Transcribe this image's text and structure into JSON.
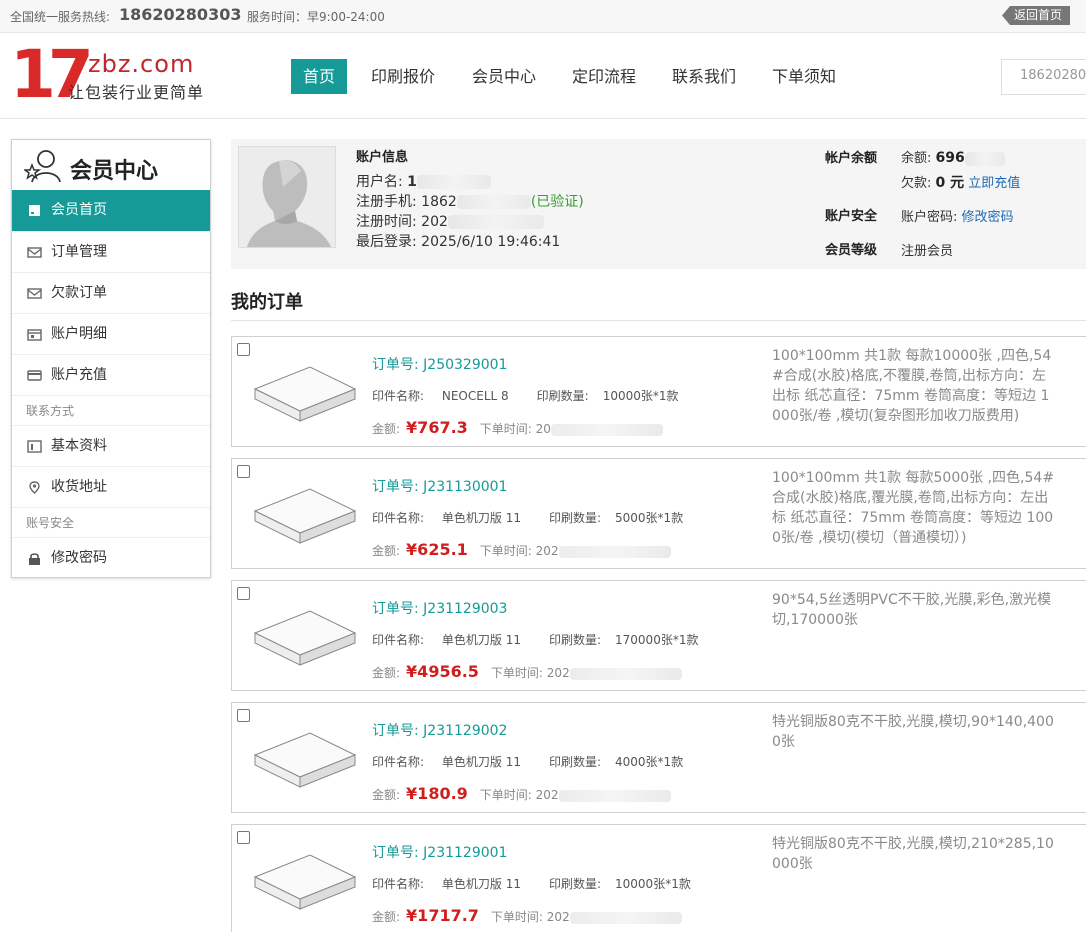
{
  "topbar": {
    "hotline_label": "全国统一服务热线:",
    "hotline": "18620280303",
    "service_time": "服务时间：早9:00-24:00",
    "back_home": "返回首页"
  },
  "logo": {
    "number": "17",
    "domain": "zbz.com",
    "slogan": "让包装行业更简单"
  },
  "nav": {
    "items": [
      "首页",
      "印刷报价",
      "会员中心",
      "定印流程",
      "联系我们",
      "下单须知"
    ],
    "active": "首页"
  },
  "header_search": {
    "value": "18620280"
  },
  "sidebar": {
    "title": "会员中心",
    "items": [
      {
        "label": "会员首页",
        "icon": "home-icon"
      },
      {
        "label": "订单管理",
        "icon": "envelope-icon"
      },
      {
        "label": "欠款订单",
        "icon": "envelope-icon"
      },
      {
        "label": "账户明细",
        "icon": "calendar-icon"
      },
      {
        "label": "账户充值",
        "icon": "card-icon"
      }
    ],
    "section_contact": "联系方式",
    "contact_items": [
      {
        "label": "基本资料",
        "icon": "profile-icon"
      },
      {
        "label": "收货地址",
        "icon": "location-icon"
      }
    ],
    "section_security": "账号安全",
    "security_items": [
      {
        "label": "修改密码",
        "icon": "lock-icon"
      }
    ]
  },
  "account": {
    "title": "账户信息",
    "username_label": "用户名:",
    "username": "1",
    "phone_label": "注册手机:",
    "phone": "1862",
    "verified": "(已验证)",
    "reg_time_label": "注册时间:",
    "reg_time": "202",
    "last_login_label": "最后登录:",
    "last_login": "2025/6/10 19:46:41",
    "balance_label": "帐户余额",
    "balance_amount_label": "余额:",
    "balance_amount": "696",
    "debt_label": "欠款:",
    "debt_amount": "0 元",
    "recharge_link": "立即充值",
    "security_label": "账户安全",
    "password_label": "账户密码:",
    "change_password_link": "修改密码",
    "level_label": "会员等级",
    "level_value": "注册会员"
  },
  "orders_title": "我的订单",
  "order_labels": {
    "no": "订单号:",
    "product": "印件名称:",
    "qty": "印刷数量:",
    "amount": "金额:",
    "time": "下单时间:"
  },
  "orders": [
    {
      "no": "J250329001",
      "product": "NEOCELL 8",
      "qty": "10000张*1款",
      "amount": "¥767.3",
      "time": "20",
      "desc": "100*100mm 共1款 每款10000张 ,四色,54#合成(水胶)格底,不覆膜,卷筒,出标方向：左出标 纸芯直径：75mm 卷筒高度：等短边 1000张/卷 ,模切(复杂图形加收刀版费用)"
    },
    {
      "no": "J231130001",
      "product": "单色机刀版 11",
      "qty": "5000张*1款",
      "amount": "¥625.1",
      "time": "202",
      "desc": "100*100mm 共1款 每款5000张 ,四色,54#合成(水胶)格底,覆光膜,卷筒,出标方向：左出标 纸芯直径：75mm 卷筒高度：等短边 1000张/卷 ,模切(模切（普通模切）)"
    },
    {
      "no": "J231129003",
      "product": "单色机刀版 11",
      "qty": "170000张*1款",
      "amount": "¥4956.5",
      "time": "202",
      "desc": "90*54,5丝透明PVC不干胶,光膜,彩色,激光模切,170000张"
    },
    {
      "no": "J231129002",
      "product": "单色机刀版 11",
      "qty": "4000张*1款",
      "amount": "¥180.9",
      "time": "202",
      "desc": "特光铜版80克不干胶,光膜,模切,90*140,4000张"
    },
    {
      "no": "J231129001",
      "product": "单色机刀版 11",
      "qty": "10000张*1款",
      "amount": "¥1717.7",
      "time": "202",
      "desc": "特光铜版80克不干胶,光膜,模切,210*285,10000张"
    }
  ],
  "colors": {
    "accent": "#169a98",
    "price": "#d01e1e",
    "logo_red": "#d92929",
    "link": "#1a6bb5"
  }
}
